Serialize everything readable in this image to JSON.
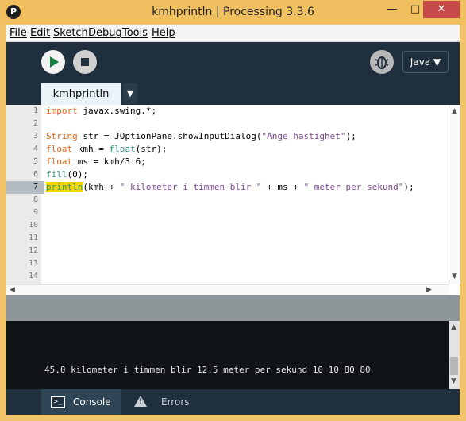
{
  "window": {
    "title": "kmhprintln | Processing 3.3.6",
    "logo": "P",
    "minimize": "—",
    "maximize": "□",
    "close": "✕"
  },
  "menu": [
    "File",
    "Edit",
    "Sketch",
    "Debug",
    "Tools",
    "Help"
  ],
  "toolbar": {
    "run_icon": "play-icon",
    "stop_icon": "stop-icon",
    "debug_icon": "bug-icon",
    "mode": "Java ▼"
  },
  "tabs": {
    "active": "kmhprintln",
    "menu_arrow": "▼"
  },
  "editor": {
    "current_line": 7,
    "line_numbers": [
      "1",
      "2",
      "3",
      "4",
      "5",
      "6",
      "7",
      "8",
      "9",
      "10",
      "11",
      "12",
      "13",
      "14"
    ],
    "lines": [
      "import javax.swing.*;",
      "",
      "String str = JOptionPane.showInputDialog(\"Ange hastighet\");",
      "float kmh = float(str);",
      "float ms = kmh/3.6;",
      "fill(0);",
      "println(kmh + \" kilometer i timmen blir \" + ms + \" meter per sekund\");",
      "",
      "",
      "",
      "",
      "",
      "",
      ""
    ]
  },
  "console": {
    "output": "45.0 kilometer i timmen blir 12.5 meter per sekund 10 10 80 80"
  },
  "bottom_tabs": {
    "console": "Console",
    "errors": "Errors"
  },
  "colors": {
    "keyword": "#e2661a",
    "function": "#33997e",
    "string": "#7d4793",
    "highlight": "#f5d300",
    "toolbar": "#1f2f3d"
  }
}
